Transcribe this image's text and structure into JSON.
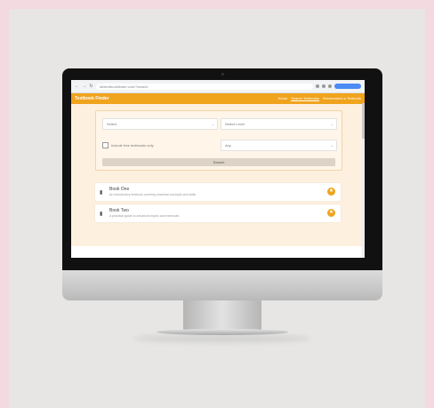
{
  "browser": {
    "url": "fabtextbookfinder.com/?search",
    "back": "←",
    "forward": "→",
    "reload": "↻"
  },
  "app": {
    "brand": "Textbook Finder",
    "nav": [
      {
        "label": "Home",
        "active": false
      },
      {
        "label": "Search Textbooks",
        "active": true
      },
      {
        "label": "Recommend a Textbook",
        "active": false
      }
    ]
  },
  "filters": {
    "subject": {
      "value": "Select"
    },
    "level": {
      "value": "Select Level"
    },
    "checkbox_label": "Include free textbooks only",
    "format": {
      "value": "Any"
    },
    "search_label": "Search"
  },
  "results": [
    {
      "title": "Book One",
      "subtitle": "An introductory textbook covering essential concepts and skills"
    },
    {
      "title": "Book Two",
      "subtitle": "A practical guide to advanced topics and exercises"
    }
  ],
  "colors": {
    "accent": "#f0a31d",
    "panel": "#fdf0de"
  }
}
